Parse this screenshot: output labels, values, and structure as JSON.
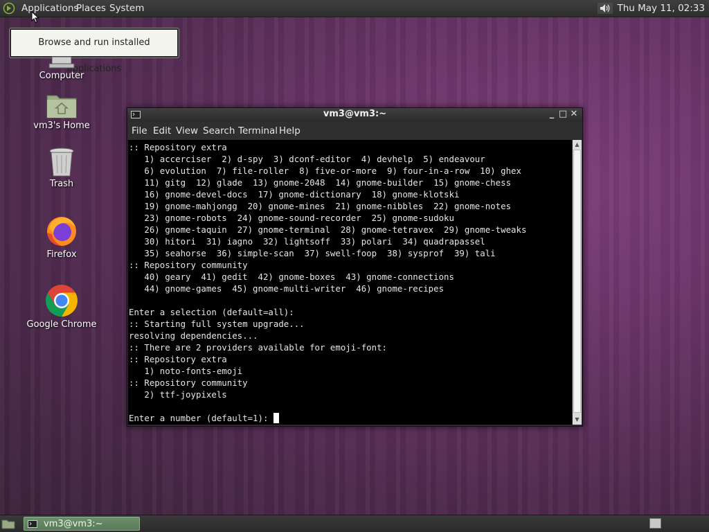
{
  "top_panel": {
    "menus": [
      "Applications",
      "Places",
      "System"
    ],
    "clock": "Thu May 11, 02:33",
    "volume_icon": "speaker-volume-icon"
  },
  "tooltip": {
    "text": "Browse and run installed applications"
  },
  "desktop_icons": [
    {
      "label": "Computer",
      "icon": "computer-icon"
    },
    {
      "label": "vm3's Home",
      "icon": "home-folder-icon"
    },
    {
      "label": "Trash",
      "icon": "trash-icon"
    },
    {
      "label": "Firefox",
      "icon": "firefox-icon"
    },
    {
      "label": "Google Chrome",
      "icon": "chrome-icon"
    }
  ],
  "terminal": {
    "title": "vm3@vm3:~",
    "menu": [
      "File",
      "Edit",
      "View",
      "Search",
      "Terminal",
      "Help"
    ],
    "lines": [
      ":: Repository extra",
      "   1) accerciser  2) d-spy  3) dconf-editor  4) devhelp  5) endeavour",
      "   6) evolution  7) file-roller  8) five-or-more  9) four-in-a-row  10) ghex",
      "   11) gitg  12) glade  13) gnome-2048  14) gnome-builder  15) gnome-chess",
      "   16) gnome-devel-docs  17) gnome-dictionary  18) gnome-klotski",
      "   19) gnome-mahjongg  20) gnome-mines  21) gnome-nibbles  22) gnome-notes",
      "   23) gnome-robots  24) gnome-sound-recorder  25) gnome-sudoku",
      "   26) gnome-taquin  27) gnome-terminal  28) gnome-tetravex  29) gnome-tweaks",
      "   30) hitori  31) iagno  32) lightsoff  33) polari  34) quadrapassel",
      "   35) seahorse  36) simple-scan  37) swell-foop  38) sysprof  39) tali",
      ":: Repository community",
      "   40) geary  41) gedit  42) gnome-boxes  43) gnome-connections",
      "   44) gnome-games  45) gnome-multi-writer  46) gnome-recipes",
      "",
      "Enter a selection (default=all):",
      ":: Starting full system upgrade...",
      "resolving dependencies...",
      ":: There are 2 providers available for emoji-font:",
      ":: Repository extra",
      "   1) noto-fonts-emoji",
      ":: Repository community",
      "   2) ttf-joypixels",
      ""
    ],
    "prompt": "Enter a number (default=1): "
  },
  "taskbar": {
    "task_label": "vm3@vm3:~"
  }
}
